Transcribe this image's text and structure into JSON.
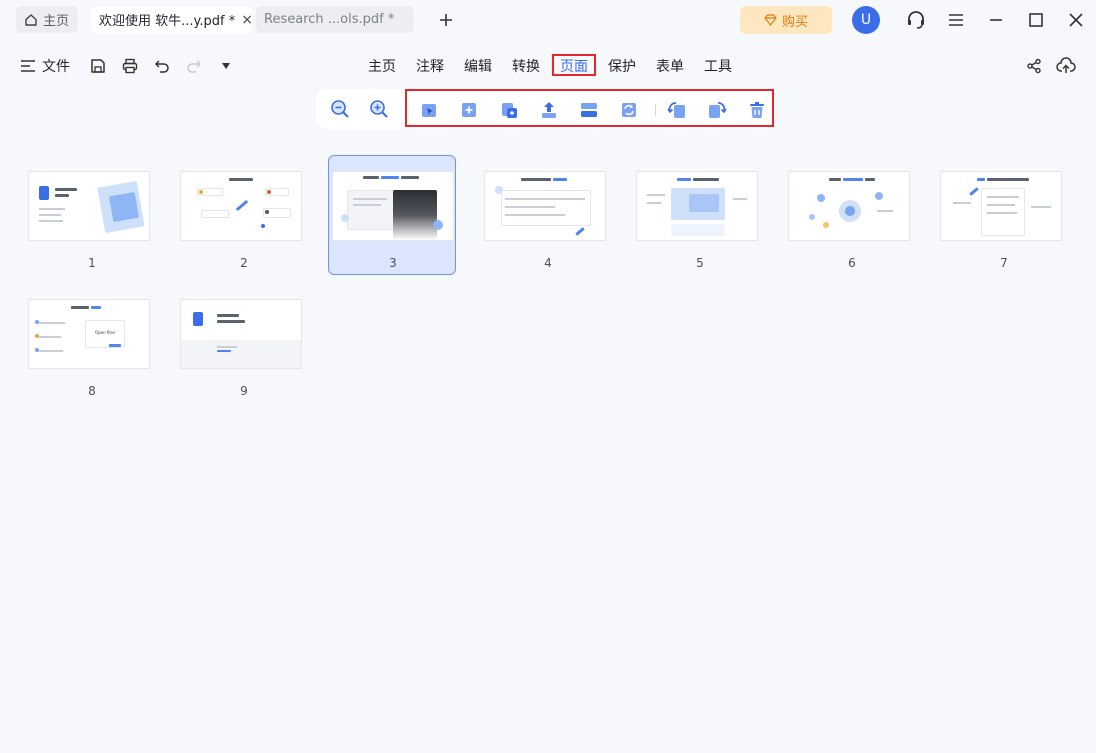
{
  "tabs": {
    "home": "主页",
    "doc1": "欢迎使用 软牛...y.pdf *",
    "doc2": "Research ...ols.pdf *",
    "close_glyph": "×",
    "new_tab_glyph": "+"
  },
  "header": {
    "buy_label": "购买",
    "avatar_letter": "U"
  },
  "menubar": {
    "file_label": "文件",
    "items": [
      "主页",
      "注释",
      "编辑",
      "转换",
      "页面",
      "保护",
      "表单",
      "工具"
    ],
    "active_index": 4
  },
  "pages": {
    "labels": [
      "1",
      "2",
      "3",
      "4",
      "5",
      "6",
      "7",
      "8",
      "9"
    ],
    "selected_index": 2,
    "thumb8_button_text": "Open files"
  },
  "colors": {
    "accent": "#3b6de8",
    "highlight_border": "#e0282e",
    "buy_bg": "#fde7c0",
    "buy_text": "#e07b0b"
  },
  "icons": {
    "home_tab": "house-icon",
    "buy": "diamond-icon",
    "support": "headset-icon",
    "menu": "hamburger-icon",
    "file_menu": "list-icon",
    "save": "floppy-icon",
    "print": "printer-icon",
    "undo": "undo-icon",
    "redo": "redo-icon",
    "more": "caret-down-icon",
    "share": "share-icon",
    "cloud": "cloud-upload-icon"
  }
}
